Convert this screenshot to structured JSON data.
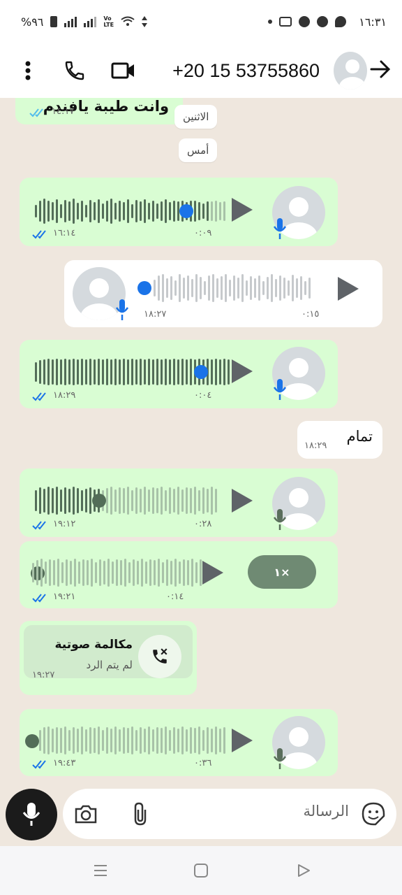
{
  "status_bar": {
    "time": "١٦:٣١",
    "battery": "%٩٦"
  },
  "header": {
    "title": "+20 15 53755860"
  },
  "messages": {
    "first_text": "وانت طيبة يافندم",
    "first_time": "١٤:١٧",
    "date_monday": "الاثنين",
    "date_yesterday": "أمس",
    "v1": {
      "duration": "٠:٠٩",
      "time": "١٦:١٤"
    },
    "v2": {
      "duration": "٠:١٥",
      "time": "١٨:٢٧"
    },
    "v3": {
      "duration": "٠:٠٤",
      "time": "١٨:٢٩"
    },
    "tamam": {
      "text": "تمام",
      "time": "١٨:٢٩"
    },
    "v4": {
      "duration": "٠:٢٨",
      "time": "١٩:١٢"
    },
    "v5": {
      "duration": "٠:١٤",
      "time": "١٩:٢١",
      "speed": "١×"
    },
    "call": {
      "title": "مكالمة صوتية",
      "status": "لم يتم الرد",
      "time": "١٩:٢٧"
    },
    "v6": {
      "duration": "٠:٣٦",
      "time": "١٩:٤٣"
    }
  },
  "input": {
    "placeholder": "الرسالة"
  },
  "colors": {
    "accent_blue": "#1a73e8",
    "out_bubble": "#d9fdd3",
    "tick_blue": "#53bdeb"
  }
}
